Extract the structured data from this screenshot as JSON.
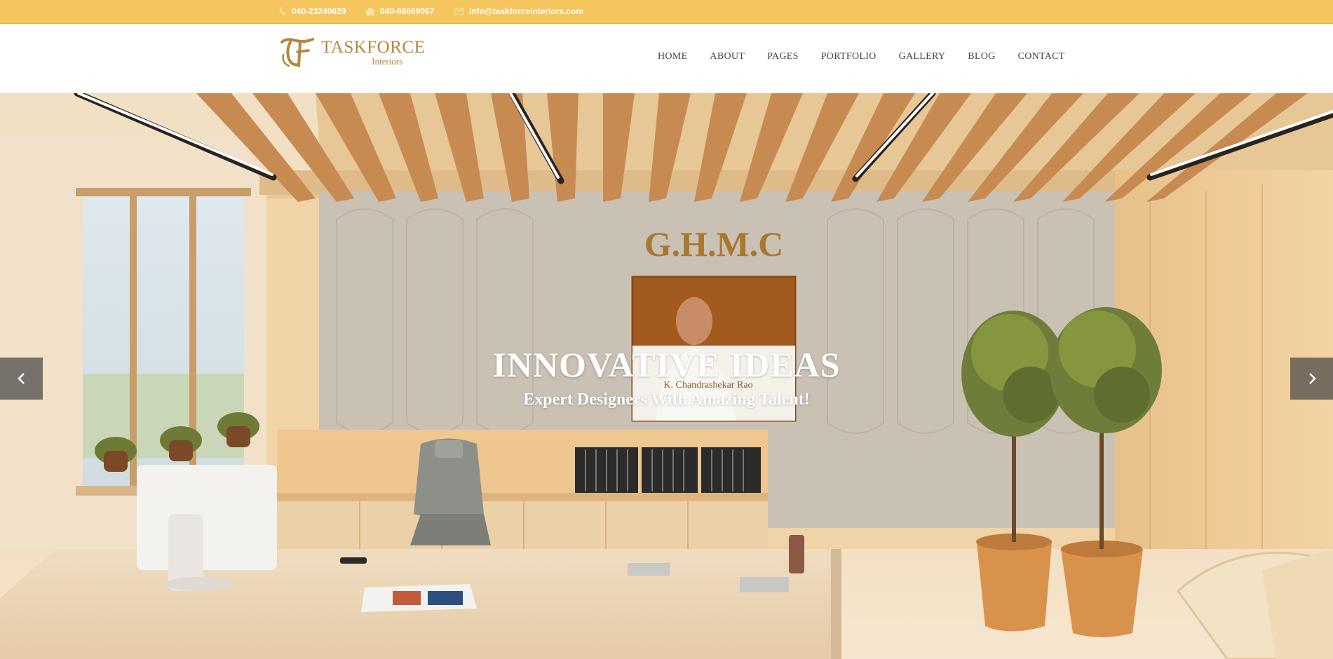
{
  "topbar": {
    "phone1": "040-23240629",
    "phone2": "040-66669067",
    "email": "info@taskforceinteriors.com",
    "icons": [
      "phone-icon",
      "fax-icon",
      "email-icon"
    ]
  },
  "logo": {
    "name": "TASKFORCE",
    "sub": "Interiors",
    "mark_icon": "tf-monogram-icon"
  },
  "nav": {
    "items": [
      "HOME",
      "ABOUT",
      "PAGES",
      "PORTFOLIO",
      "GALLERY",
      "BLOG",
      "CONTACT"
    ]
  },
  "hero": {
    "title": "INNOVATIVE IDEAS",
    "subtitle": "Expert Designers With Amazing Talent!",
    "wall_sign": "G.H.M.C",
    "portrait_caption": "K. Chandrashekar Rao",
    "prev_icon": "chevron-left-icon",
    "next_icon": "chevron-right-icon"
  },
  "colors": {
    "topbar_bg": "#f5c55e",
    "brand_gold": "#b3873c",
    "nav_text": "#444444",
    "slider_arrow_bg": "#464646"
  }
}
